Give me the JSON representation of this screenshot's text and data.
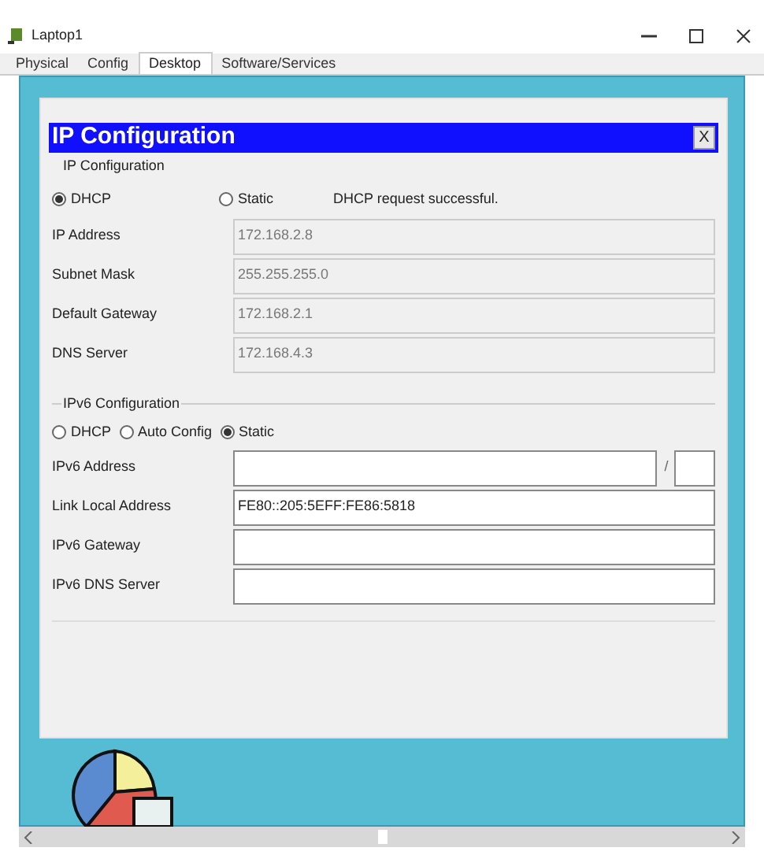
{
  "window": {
    "title": "Laptop1"
  },
  "tabs": [
    {
      "label": "Physical",
      "selected": false
    },
    {
      "label": "Config",
      "selected": false
    },
    {
      "label": "Desktop",
      "selected": true
    },
    {
      "label": "Software/Services",
      "selected": false
    }
  ],
  "dialog": {
    "title": "IP Configuration",
    "close": "X"
  },
  "ipv4": {
    "legend": "IP Configuration",
    "modes": [
      {
        "label": "DHCP",
        "selected": true
      },
      {
        "label": "Static",
        "selected": false
      }
    ],
    "status": "DHCP request successful.",
    "fields": [
      {
        "label": "IP Address",
        "value": "172.168.2.8",
        "disabled": true
      },
      {
        "label": "Subnet Mask",
        "value": "255.255.255.0",
        "disabled": true
      },
      {
        "label": "Default Gateway",
        "value": "172.168.2.1",
        "disabled": true
      },
      {
        "label": "DNS Server",
        "value": "172.168.4.3",
        "disabled": true
      }
    ]
  },
  "ipv6": {
    "legend": "IPv6 Configuration",
    "modes": [
      {
        "label": "DHCP",
        "selected": false
      },
      {
        "label": "Auto Config",
        "selected": false
      },
      {
        "label": "Static",
        "selected": true
      }
    ],
    "fields": [
      {
        "label": "IPv6 Address",
        "kind": "prefixed",
        "separator": "/",
        "disabled": false
      },
      {
        "label": "Link Local Address",
        "kind": "plain",
        "value": "FE80::205:5EFF:FE86:5818",
        "disabled": false
      },
      {
        "label": "IPv6 Gateway",
        "kind": "plain",
        "disabled": false
      },
      {
        "label": "IPv6 DNS Server",
        "kind": "plain",
        "disabled": false
      }
    ]
  }
}
